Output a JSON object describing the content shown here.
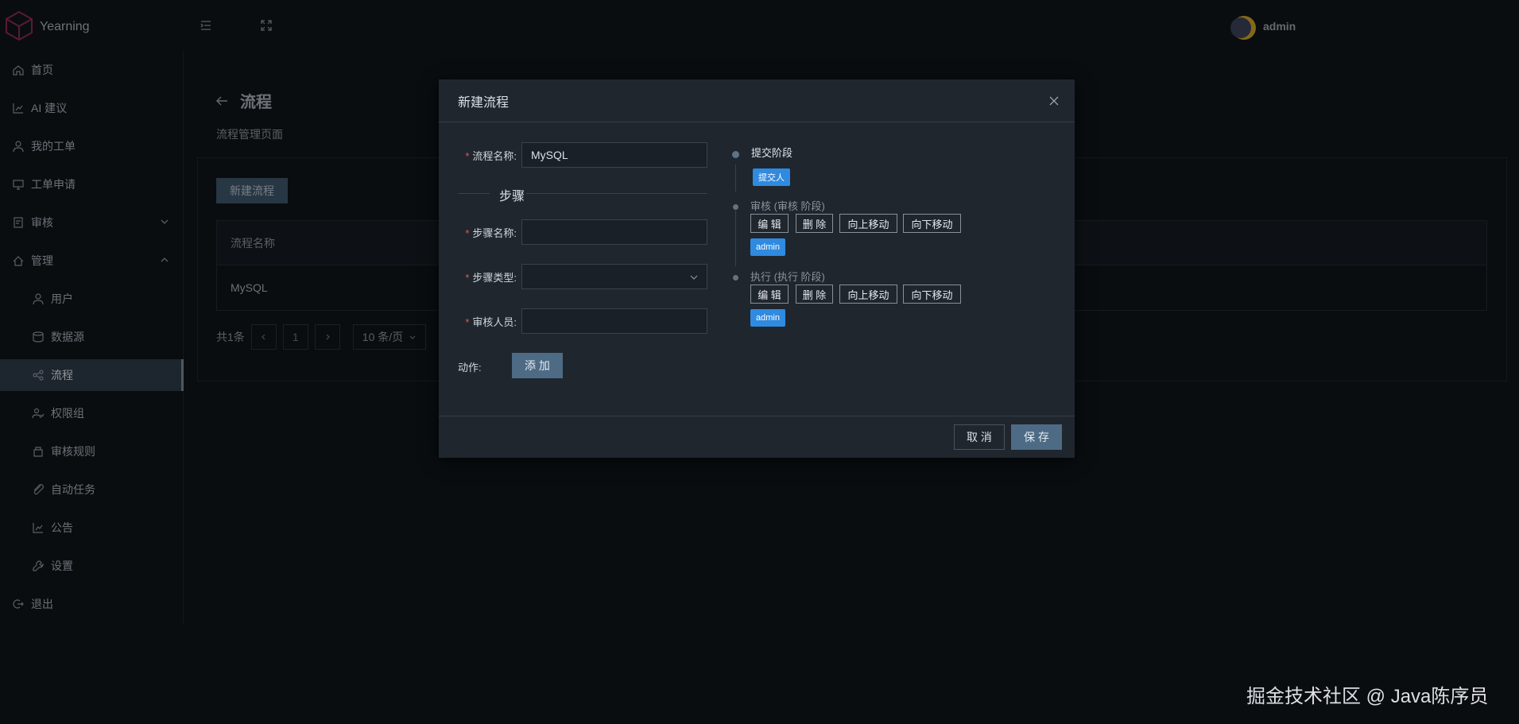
{
  "app": {
    "name": "Yearning",
    "username": "admin"
  },
  "sidebar": {
    "items": [
      {
        "label": "首页",
        "icon": "home-icon"
      },
      {
        "label": "AI 建议",
        "icon": "chart-icon"
      },
      {
        "label": "我的工单",
        "icon": "user-icon"
      },
      {
        "label": "工单申请",
        "icon": "monitor-icon"
      },
      {
        "label": "审核",
        "icon": "audit-icon"
      },
      {
        "label": "管理",
        "icon": "manage-icon"
      },
      {
        "label": "用户",
        "icon": "user-icon"
      },
      {
        "label": "数据源",
        "icon": "database-icon"
      },
      {
        "label": "流程",
        "icon": "flow-icon",
        "active": true
      },
      {
        "label": "权限组",
        "icon": "group-icon"
      },
      {
        "label": "审核规则",
        "icon": "rule-icon"
      },
      {
        "label": "自动任务",
        "icon": "task-icon"
      },
      {
        "label": "公告",
        "icon": "notice-icon"
      },
      {
        "label": "设置",
        "icon": "settings-icon"
      },
      {
        "label": "退出",
        "icon": "logout-icon"
      }
    ]
  },
  "page": {
    "title": "流程",
    "subtitle": "流程管理页面",
    "new_button": "新建流程",
    "table": {
      "columns": [
        "流程名称"
      ],
      "rows": [
        [
          "MySQL"
        ]
      ]
    },
    "pagination": {
      "total_text": "共1条",
      "current_page": "1",
      "page_size": "10 条/页"
    }
  },
  "modal": {
    "title": "新建流程",
    "fields": {
      "flow_name_label": "流程名称:",
      "flow_name_value": "MySQL",
      "steps_divider": "步骤",
      "step_name_label": "步骤名称:",
      "step_type_label": "步骤类型:",
      "reviewer_label": "审核人员:",
      "action_label": "动作:",
      "add_button": "添 加"
    },
    "timeline": [
      {
        "title": "提交阶段",
        "tags": [
          "提交人"
        ]
      },
      {
        "title": "审核 (审核 阶段)",
        "tags": [
          "admin"
        ],
        "actions": [
          "编 辑",
          "删 除",
          "向上移动",
          "向下移动"
        ]
      },
      {
        "title": "执行 (执行 阶段)",
        "tags": [
          "admin"
        ],
        "actions": [
          "编 辑",
          "删 除",
          "向上移动",
          "向下移动"
        ]
      }
    ],
    "footer": {
      "cancel": "取 消",
      "save": "保 存"
    }
  },
  "watermark": "掘金技术社区 @ Java陈序员",
  "colors": {
    "primary": "#4e6b85",
    "tag_blue": "#2f8ae0",
    "required": "#e05757",
    "background": "#0f1419",
    "modal_bg": "#1f262e"
  }
}
